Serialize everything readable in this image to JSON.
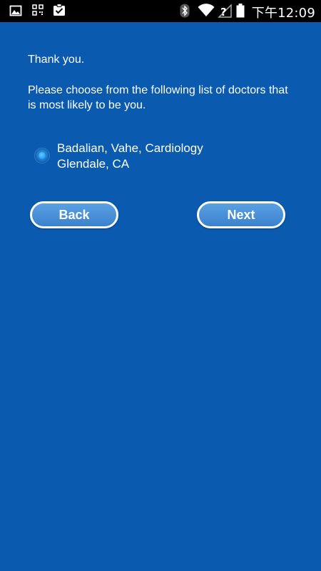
{
  "status_bar": {
    "time": "下午12:09",
    "left_icons": [
      "gallery-icon",
      "qr-code-icon",
      "clipboard-check-icon"
    ],
    "right_icons": [
      "bluetooth-icon",
      "wifi-icon",
      "no-sim-icon",
      "battery-icon"
    ]
  },
  "content": {
    "thanks": "Thank you.",
    "instructions": "Please choose from the following list of doctors that is most likely to be you.",
    "doctors": [
      {
        "line1": "Badalian, Vahe, Cardiology",
        "line2": "Glendale, CA",
        "selected": true
      }
    ]
  },
  "buttons": {
    "back": "Back",
    "next": "Next"
  },
  "colors": {
    "background": "#0a5ab0",
    "status_bar": "#000000",
    "button_fill": "#4a92da",
    "button_border": "#ffffff"
  }
}
